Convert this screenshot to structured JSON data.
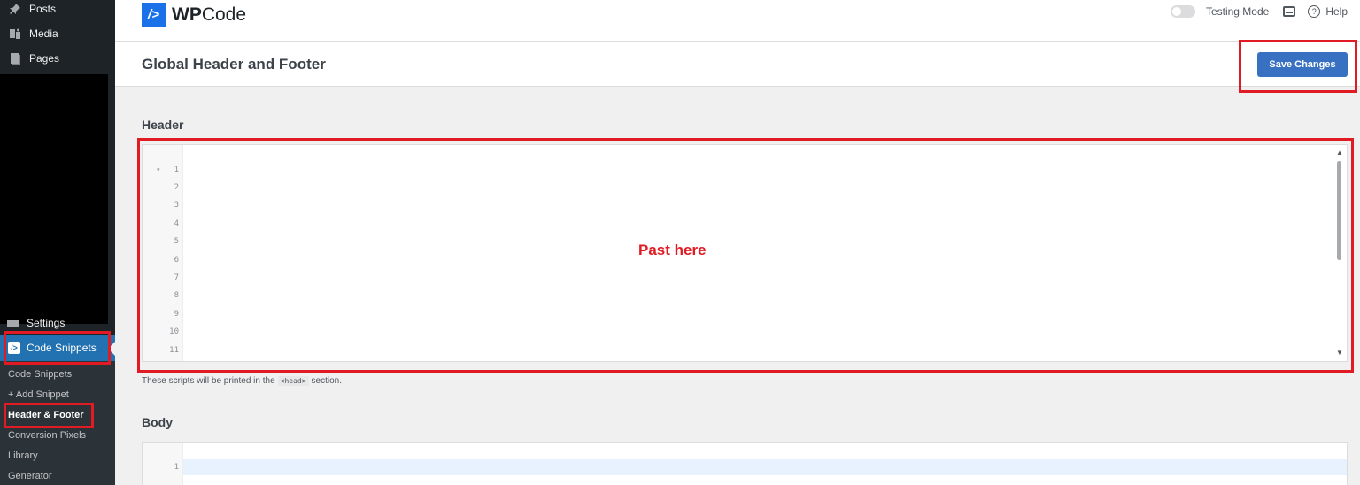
{
  "sidebar": {
    "items": [
      {
        "label": "Posts",
        "icon": "pin-icon"
      },
      {
        "label": "Media",
        "icon": "media-icon"
      },
      {
        "label": "Pages",
        "icon": "pages-icon"
      }
    ],
    "settings_label": "Settings",
    "active_label": "Code Snippets",
    "active_icon_glyph": "/>",
    "submenu": [
      "Code Snippets",
      "+ Add Snippet",
      "Header & Footer",
      "Conversion Pixels",
      "Library",
      "Generator"
    ]
  },
  "topbar": {
    "logo_mark": "/>",
    "logo_bold": "WP",
    "logo_rest": "Code",
    "testing_mode_label": "Testing Mode",
    "help_label": "Help"
  },
  "titlebar": {
    "title": "Global Header and Footer",
    "save_label": "Save Changes"
  },
  "header_section": {
    "label": "Header",
    "line_numbers": [
      "1",
      "2",
      "3",
      "4",
      "5",
      "6",
      "7",
      "8",
      "9",
      "10",
      "11"
    ],
    "annotation": "Past here",
    "hint_before": "These scripts will be printed in the",
    "hint_code": "<head>",
    "hint_after": "section."
  },
  "body_section": {
    "label": "Body",
    "line_numbers": [
      "1"
    ]
  },
  "colors": {
    "sidebar_bg": "#1d2327",
    "active_blue": "#2271b1",
    "save_button": "#3871c1",
    "annotation_red": "#e01b24",
    "logo_blue": "#1b72e8"
  }
}
